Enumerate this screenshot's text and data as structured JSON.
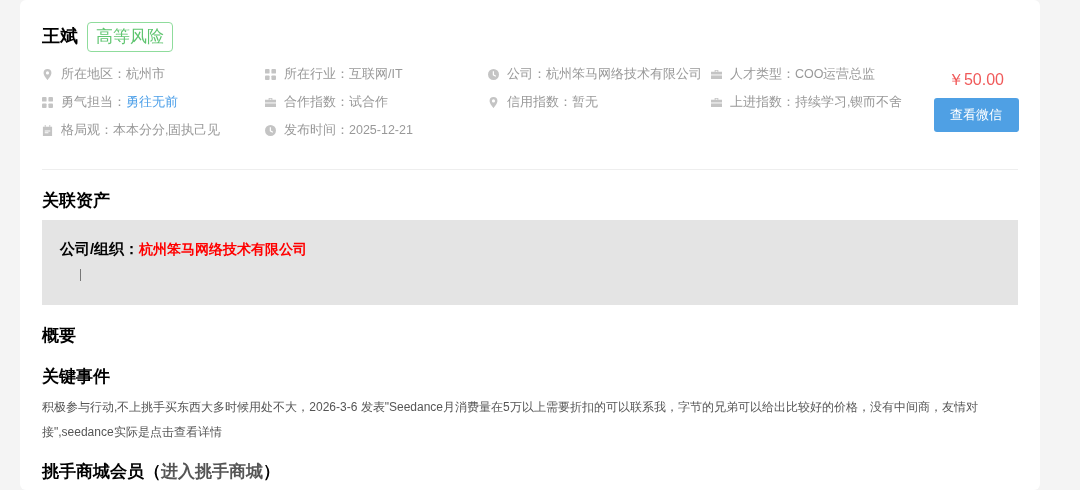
{
  "profile": {
    "name": "王斌",
    "risk_badge": "高等风险"
  },
  "info": [
    {
      "kind": "pin",
      "label": "所在地区：",
      "value": "杭州市",
      "highlight": false
    },
    {
      "kind": "grid",
      "label": "所在行业：",
      "value": "互联网/IT",
      "highlight": false
    },
    {
      "kind": "clock",
      "label": "公司：",
      "value": "杭州笨马网络技术有限公司",
      "highlight": false
    },
    {
      "kind": "briefcase",
      "label": "人才类型：",
      "value": "COO运营总监",
      "highlight": false
    },
    {
      "kind": "grid",
      "label": "勇气担当：",
      "value": "勇往无前",
      "highlight": true
    },
    {
      "kind": "briefcase",
      "label": "合作指数：",
      "value": "试合作",
      "highlight": false
    },
    {
      "kind": "pin",
      "label": "信用指数：",
      "value": "暂无",
      "highlight": false
    },
    {
      "kind": "briefcase",
      "label": "上进指数：",
      "value": "持续学习,锲而不舍",
      "highlight": false
    },
    {
      "kind": "calendar",
      "label": "格局观：",
      "value": "本本分分,固执己见",
      "highlight": false
    },
    {
      "kind": "clock",
      "label": "发布时间：",
      "value": "2025-12-21",
      "highlight": false
    }
  ],
  "price": "￥50.00",
  "button": "查看微信",
  "assets": {
    "heading": "关联资产",
    "label": "公司/组织：",
    "value": "杭州笨马网络技术有限公司"
  },
  "overview": {
    "heading": "概要"
  },
  "key_events": {
    "heading": "关键事件",
    "text": "积极参与行动,不上挑手买东西大多时候用处不大，2026-3-6 发表\"Seedance月消费量在5万以上需要折扣的可以联系我，字节的兄弟可以给出比较好的价格，没有中间商，友情对接\",seedance实际是点击查看详情"
  },
  "mall": {
    "heading": "挑手商城会员（",
    "link": "进入挑手商城",
    "close": "）"
  }
}
